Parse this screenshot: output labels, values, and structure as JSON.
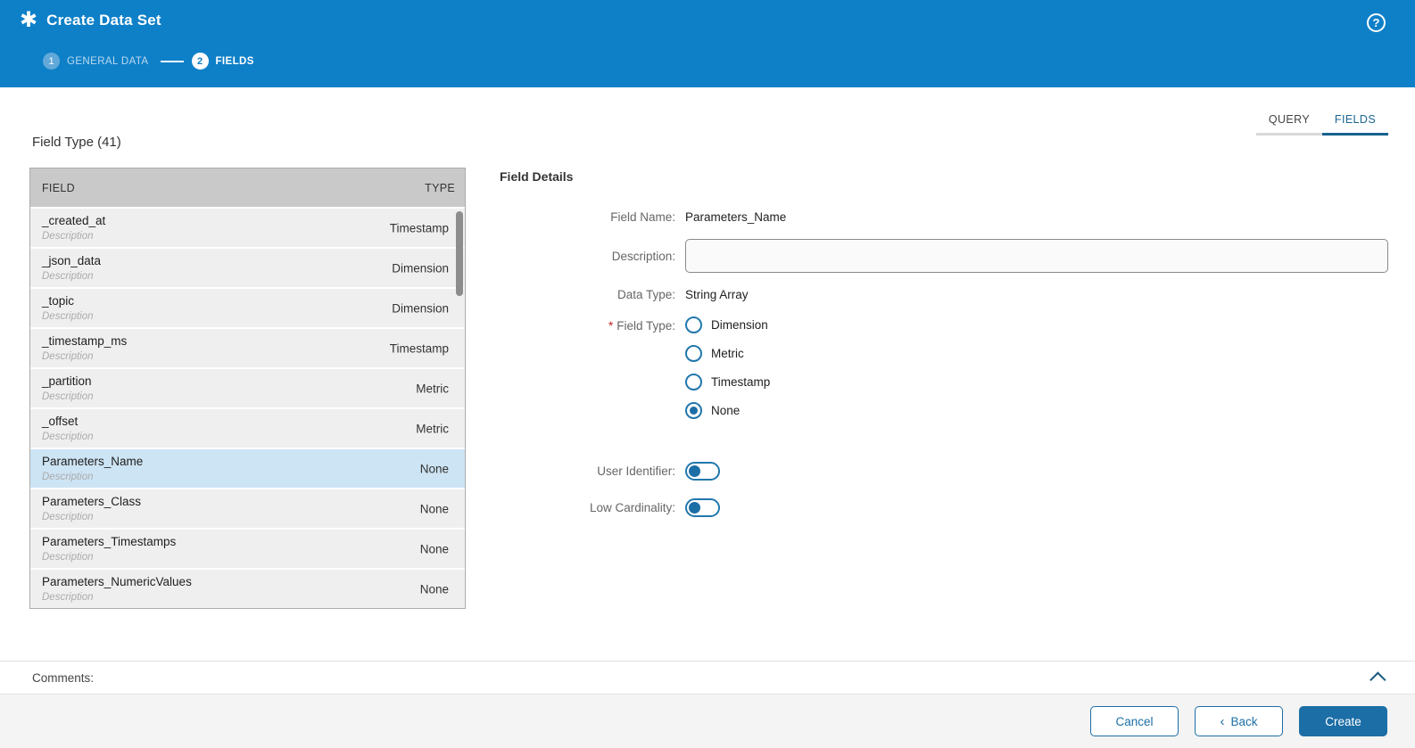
{
  "colors": {
    "header_bg": "#0e80c8",
    "accent_blue": "#1c6ea6",
    "selected_row_bg": "#cde4f4",
    "list_header_bg": "#c9c9c9",
    "row_bg": "#efefef",
    "footer_bg": "#f4f4f4",
    "required_marker_red": "#c02020",
    "inactive_step_circle": "#62a9d9"
  },
  "header": {
    "title": "Create Data Set",
    "logo_icon": "asterisk-icon",
    "help_icon": "?",
    "steps": [
      {
        "number": "1",
        "label": "GENERAL DATA",
        "state": "completed"
      },
      {
        "number": "2",
        "label": "FIELDS",
        "state": "active"
      }
    ]
  },
  "tabs": [
    {
      "label": "QUERY",
      "active": false
    },
    {
      "label": "FIELDS",
      "active": true
    }
  ],
  "field_list": {
    "title": "Field Type (41)",
    "total_fields": 41,
    "columns": [
      "FIELD",
      "TYPE"
    ],
    "selected_field": "Parameters_Name",
    "rows": [
      {
        "name": "_created_at",
        "description": "Description",
        "type": "Timestamp",
        "selected": false
      },
      {
        "name": "_json_data",
        "description": "Description",
        "type": "Dimension",
        "selected": false
      },
      {
        "name": "_topic",
        "description": "Description",
        "type": "Dimension",
        "selected": false
      },
      {
        "name": "_timestamp_ms",
        "description": "Description",
        "type": "Timestamp",
        "selected": false
      },
      {
        "name": "_partition",
        "description": "Description",
        "type": "Metric",
        "selected": false
      },
      {
        "name": "_offset",
        "description": "Description",
        "type": "Metric",
        "selected": false
      },
      {
        "name": "Parameters_Name",
        "description": "Description",
        "type": "None",
        "selected": true
      },
      {
        "name": "Parameters_Class",
        "description": "Description",
        "type": "None",
        "selected": false
      },
      {
        "name": "Parameters_Timestamps",
        "description": "Description",
        "type": "None",
        "selected": false
      },
      {
        "name": "Parameters_NumericValues",
        "description": "Description",
        "type": "None",
        "selected": false
      }
    ]
  },
  "field_details": {
    "title": "Field Details",
    "field_name": {
      "label": "Field Name:",
      "value": "Parameters_Name"
    },
    "description": {
      "label": "Description:",
      "value": ""
    },
    "data_type": {
      "label": "Data Type:",
      "value": "String Array"
    },
    "field_type": {
      "label": "Field Type:",
      "required_marker": "*",
      "selected": "None",
      "options": [
        {
          "label": "Dimension",
          "selected": false
        },
        {
          "label": "Metric",
          "selected": false
        },
        {
          "label": "Timestamp",
          "selected": false
        },
        {
          "label": "None",
          "selected": true
        }
      ]
    },
    "user_identifier": {
      "label": "User Identifier:",
      "on": false
    },
    "low_cardinality": {
      "label": "Low Cardinality:",
      "on": false
    }
  },
  "comments": {
    "label": "Comments:"
  },
  "footer": {
    "cancel_label": "Cancel",
    "back_label": "Back",
    "back_chevron": "‹",
    "create_label": "Create"
  }
}
